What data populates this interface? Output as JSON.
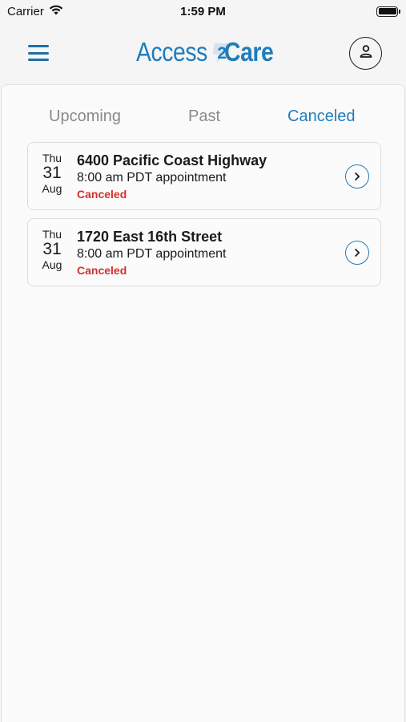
{
  "status_bar": {
    "carrier": "Carrier",
    "time": "1:59 PM"
  },
  "header": {
    "logo_part1": "Access",
    "logo_part2": "Care",
    "logo_mark": "2",
    "menu_icon": "hamburger-menu-icon",
    "profile_icon": "user-icon"
  },
  "tabs": [
    {
      "label": "Upcoming",
      "active": false
    },
    {
      "label": "Past",
      "active": false
    },
    {
      "label": "Canceled",
      "active": true
    }
  ],
  "appointments": [
    {
      "dow": "Thu",
      "day": "31",
      "month": "Aug",
      "address": "6400 Pacific Coast Highway",
      "time": "8:00 am PDT appointment",
      "status": "Canceled"
    },
    {
      "dow": "Thu",
      "day": "31",
      "month": "Aug",
      "address": "1720 East 16th Street",
      "time": "8:00 am PDT appointment",
      "status": "Canceled"
    }
  ],
  "colors": {
    "accent": "#1f7dbd",
    "canceled": "#d32f2f",
    "inactive_tab": "#8a8a8a"
  }
}
